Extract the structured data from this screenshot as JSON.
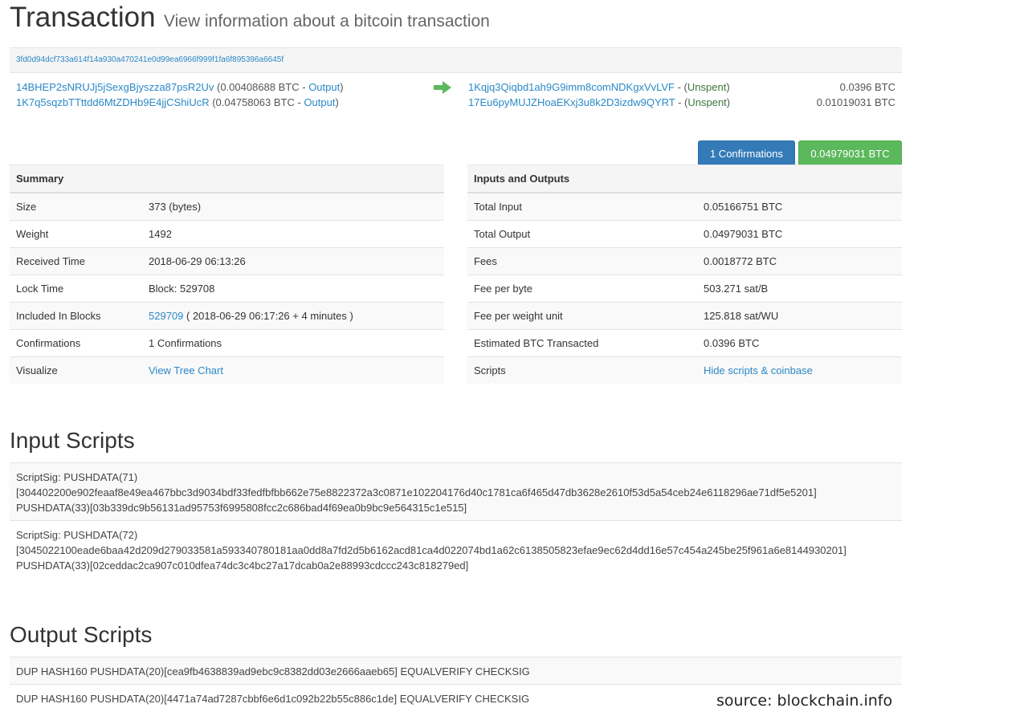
{
  "header": {
    "title": "Transaction",
    "subtitle": "View information about a bitcoin transaction"
  },
  "tx": {
    "hash": "3fd0d94dcf733a614f14a930a470241e0d99ea6966f999f1fa6f895396a6645f",
    "inputs": [
      {
        "address": "14BHEP2sNRUJj5jSexgBjyszza87psR2Uv",
        "amount_pre": " (0.00408688 BTC - ",
        "link": "Output",
        "amount_post": ")"
      },
      {
        "address": "1K7q5sqzbTTttdd6MtZDHb9E4jjCShiUcR",
        "amount_pre": " (0.04758063 BTC - ",
        "link": "Output",
        "amount_post": ")"
      }
    ],
    "outputs": [
      {
        "address": "1Kqjq3Qiqbd1ah9G9imm8comNDKgxVvLVF",
        "sep": " - (",
        "status": "Unspent",
        "close": ")",
        "amount": "0.0396 BTC"
      },
      {
        "address": "17Eu6pyMUJZHoaEKxj3u8k2D3izdw9QYRT",
        "sep": " - (",
        "status": "Unspent",
        "close": ")",
        "amount": "0.01019031 BTC"
      }
    ],
    "confirmations_button": "1 Confirmations",
    "total_button": "0.04979031 BTC"
  },
  "summary": {
    "heading": "Summary",
    "rows": {
      "size": {
        "label": "Size",
        "value": "373 (bytes)"
      },
      "weight": {
        "label": "Weight",
        "value": "1492"
      },
      "received": {
        "label": "Received Time",
        "value": "2018-06-29 06:13:26"
      },
      "lock": {
        "label": "Lock Time",
        "value": "Block: 529708"
      },
      "included": {
        "label": "Included In Blocks",
        "link": "529709",
        "rest": " ( 2018-06-29 06:17:26 + 4 minutes )"
      },
      "confirmations": {
        "label": "Confirmations",
        "value": "1 Confirmations"
      },
      "visualize": {
        "label": "Visualize",
        "link": "View Tree Chart"
      }
    }
  },
  "io": {
    "heading": "Inputs and Outputs",
    "rows": {
      "total_input": {
        "label": "Total Input",
        "value": "0.05166751 BTC"
      },
      "total_output": {
        "label": "Total Output",
        "value": "0.04979031 BTC"
      },
      "fees": {
        "label": "Fees",
        "value": "0.0018772 BTC"
      },
      "fee_byte": {
        "label": "Fee per byte",
        "value": "503.271 sat/B"
      },
      "fee_wu": {
        "label": "Fee per weight unit",
        "value": "125.818 sat/WU"
      },
      "estimated": {
        "label": "Estimated BTC Transacted",
        "value": "0.0396 BTC"
      },
      "scripts": {
        "label": "Scripts",
        "link": "Hide scripts & coinbase"
      }
    }
  },
  "input_scripts": {
    "heading": "Input Scripts",
    "items": [
      {
        "line1": "ScriptSig: PUSHDATA(71)",
        "line2": "[304402200e902feaaf8e49ea467bbc3d9034bdf33fedfbfbb662e75e8822372a3c0871e102204176d40c1781ca6f465d47db3628e2610f53d5a54ceb24e6118296ae71df5e5201]",
        "line3": "PUSHDATA(33)[03b339dc9b56131ad95753f6995808fcc2c686bad4f69ea0b9bc9e564315c1e515]"
      },
      {
        "line1": "ScriptSig: PUSHDATA(72)",
        "line2": "[3045022100eade6baa42d209d279033581a593340780181aa0dd8a7fd2d5b6162acd81ca4d022074bd1a62c6138505823efae9ec62d4dd16e57c454a245be25f961a6e8144930201]",
        "line3": "PUSHDATA(33)[02ceddac2ca907c010dfea74dc3c4bc27a17dcab0a2e88993cdccc243c818279ed]"
      }
    ]
  },
  "output_scripts": {
    "heading": "Output Scripts",
    "items": [
      "DUP HASH160 PUSHDATA(20)[cea9fb4638839ad9ebc9c8382dd03e2666aaeb65] EQUALVERIFY CHECKSIG",
      "DUP HASH160 PUSHDATA(20)[4471a74ad7287cbbf6e6d1c092b22b55c886c1de] EQUALVERIFY CHECKSIG"
    ]
  },
  "source": "source: blockchain.info",
  "colors": {
    "link": "#2a89c7",
    "primary": "#337ab7",
    "success": "#5cb85c",
    "arrow": "#5cb85c",
    "unspent": "#3c763d"
  }
}
